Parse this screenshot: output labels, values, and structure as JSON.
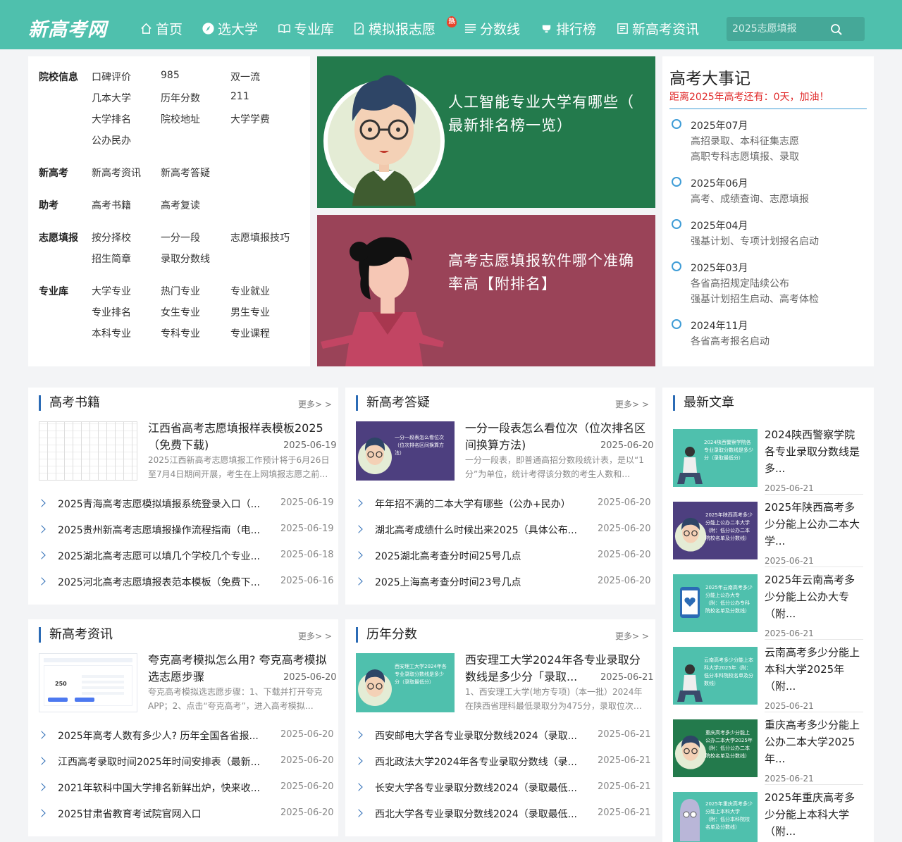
{
  "header": {
    "logo": "新高考网",
    "nav": [
      "首页",
      "选大学",
      "专业库",
      "模拟报志愿",
      "分数线",
      "排行榜",
      "新高考资讯"
    ],
    "hot_badge": "热",
    "search_placeholder": "2025志愿填报"
  },
  "categories": {
    "school_info": {
      "label": "院校信息",
      "items": [
        "口碑评价",
        "985",
        "双一流",
        "几本大学",
        "历年分数",
        "211",
        "大学排名",
        "院校地址",
        "大学学费",
        "公办民办"
      ]
    },
    "xingaokao": {
      "label": "新高考",
      "items": [
        "新高考资讯",
        "新高考答疑"
      ]
    },
    "zhukao": {
      "label": "助考",
      "items": [
        "高考书籍",
        "高考复读"
      ]
    },
    "zhiyuan": {
      "label": "志愿填报",
      "items": [
        "按分择校",
        "一分一段",
        "志愿填报技巧",
        "招生简章",
        "录取分数线"
      ]
    },
    "zhuanye": {
      "label": "专业库",
      "items": [
        "大学专业",
        "热门专业",
        "专业就业",
        "专业排名",
        "女生专业",
        "男生专业",
        "本科专业",
        "专科专业",
        "专业课程"
      ]
    }
  },
  "banners": [
    {
      "title": "人工智能专业大学有哪些（最新排名榜一览）",
      "line1": "人工智能专业大学有哪些（",
      "line2": "最新排名榜一览）",
      "color": "#237a4c"
    },
    {
      "title": "高考志愿填报软件哪个准确率高【附排名】",
      "line1": "高考志愿填报软件哪个准确",
      "line2": "率高【附排名】",
      "color": "#9a4358"
    }
  ],
  "events": {
    "title": "高考大事记",
    "countdown": "距离2025年高考还有：0天，加油！",
    "items": [
      {
        "date": "2025年07月",
        "lines": [
          "高招录取、本科征集志愿",
          "高职专科志愿填报、录取"
        ]
      },
      {
        "date": "2025年06月",
        "lines": [
          "高考、成绩查询、志愿填报"
        ]
      },
      {
        "date": "2025年04月",
        "lines": [
          "强基计划、专项计划报名启动"
        ]
      },
      {
        "date": "2025年03月",
        "lines": [
          "各省高招规定陆续公布",
          "强基计划招生启动、高考体检"
        ]
      },
      {
        "date": "2024年11月",
        "lines": [
          "各省高考报名启动"
        ]
      }
    ]
  },
  "more_label": "更多> >",
  "panels": {
    "books": {
      "title": "高考书籍",
      "feature": {
        "title": "江西省高考志愿填报样表模板2025（免费下载)",
        "date": "2025-06-19",
        "desc": "2025江西新高考志愿填报工作预计将于6月26日至7月4日期间开展，考生在上网填报志愿之前…"
      },
      "list": [
        {
          "title": "2025青海高考志愿模拟填报系统登录入口（...",
          "date": "2025-06-19"
        },
        {
          "title": "2025贵州新高考志愿填报操作流程指南（电...",
          "date": "2025-06-19"
        },
        {
          "title": "2025湖北高考志愿可以填几个学校几个专业...",
          "date": "2025-06-18"
        },
        {
          "title": "2025河北高考志愿填报表范本模板（免费下...",
          "date": "2025-06-16"
        }
      ]
    },
    "qa": {
      "title": "新高考答疑",
      "feature": {
        "title": "一分一段表怎么看位次（位次排名区间换算方法)",
        "date": "2025-06-20",
        "desc": "一分一段表，即普通高招分数段统计表，是以“1分”为单位，统计考得该分数的考生人数和…",
        "thumb_text": "一分一段表怎么看位次（位次排名区间换算方法）"
      },
      "list": [
        {
          "title": "年年招不满的二本大学有哪些（公办+民办）",
          "date": "2025-06-20"
        },
        {
          "title": "湖北高考成绩什么时候出来2025（具体公布...",
          "date": "2025-06-20"
        },
        {
          "title": "2025湖北高考查分时间25号几点",
          "date": "2025-06-20"
        },
        {
          "title": "2025上海高考查分时间23号几点",
          "date": "2025-06-20"
        }
      ]
    },
    "news": {
      "title": "新高考资讯",
      "feature": {
        "title": "夸克高考模拟怎么用? 夸克高考模拟选志愿步骤",
        "date": "2025-06-20",
        "desc": "夸克高考模拟选志愿步骤：1、下载并打开夸克APP；2、点击“夸克高考”，进入高考模拟…",
        "thumb_number": "250"
      },
      "list": [
        {
          "title": "2025年高考人数有多少人? 历年全国各省报...",
          "date": "2025-06-20"
        },
        {
          "title": "江西高考录取时间2025年时间安排表（最新...",
          "date": "2025-06-20"
        },
        {
          "title": "2021年软科中国大学排名新鲜出炉，快来收...",
          "date": "2025-06-20"
        },
        {
          "title": "2025甘肃省教育考试院官网入口",
          "date": "2025-06-20"
        }
      ]
    },
    "scores": {
      "title": "历年分数",
      "feature": {
        "title": "西安理工大学2024年各专业录取分数线是多少分「录取...",
        "date": "2025-06-21",
        "desc": "1、西安理工大学(地方专项)（本一批）2024年在陕西省理科最低录取分为475分，录取位次…",
        "thumb_text": "西安理工大学2024年各专业录取分数线是多少分（录取最低分）"
      },
      "list": [
        {
          "title": "西安邮电大学各专业录取分数线2024（录取...",
          "date": "2025-06-21"
        },
        {
          "title": "西北政法大学2024年各专业录取分数线（录...",
          "date": "2025-06-21"
        },
        {
          "title": "长安大学各专业录取分数线2024（录取最低...",
          "date": "2025-06-21"
        },
        {
          "title": "西北大学各专业录取分数线2024（录取最低...",
          "date": "2025-06-21"
        }
      ]
    }
  },
  "recent": {
    "title": "最新文章",
    "items": [
      {
        "title": "2024陕西警察学院各专业录取分数线是多...",
        "date": "2025-06-21",
        "thumb_text": "2024陕西警察学院各专业录取分数线是多少分（录取最低分）"
      },
      {
        "title": "2025年陕西高考多少分能上公办二本大学...",
        "date": "2025-06-21",
        "thumb_text": "2025年陕西高考多少分能上公办二本大学（附：低分公办二本院校名单及分数线）"
      },
      {
        "title": "2025年云南高考多少分能上公办大专（附...",
        "date": "2025-06-21",
        "thumb_text": "2025年云南高考多少分能上公办大专（附：低分公办专科院校名单及分数线）"
      },
      {
        "title": "云南高考多少分能上本科大学2025年（附...",
        "date": "2025-06-21",
        "thumb_text": "云南高考多少分能上本科大学2025年（附：低分本科院校名单及分数线）"
      },
      {
        "title": "重庆高考多少分能上公办二本大学2025年...",
        "date": "2025-06-21",
        "thumb_text": "重庆高考多少分能上公办二本大学2025年（附：低分公办二本院校名单及分数线）"
      },
      {
        "title": "2025年重庆高考多少分能上本科大学（附...",
        "date": "",
        "thumb_text": "2025年重庆高考多少分能上本科大学（附：低分本科院校名单及分数线）"
      }
    ]
  },
  "colors": {
    "header": "#4fc0ad",
    "accent_blue": "#2b6bb5",
    "countdown_red": "#e02a2a",
    "banner_green": "#237a4c",
    "banner_red": "#9a4358",
    "thumb_purple": "#4d3f7f",
    "thumb_teal": "#4fc0ad",
    "thumb_green": "#237a4c"
  }
}
